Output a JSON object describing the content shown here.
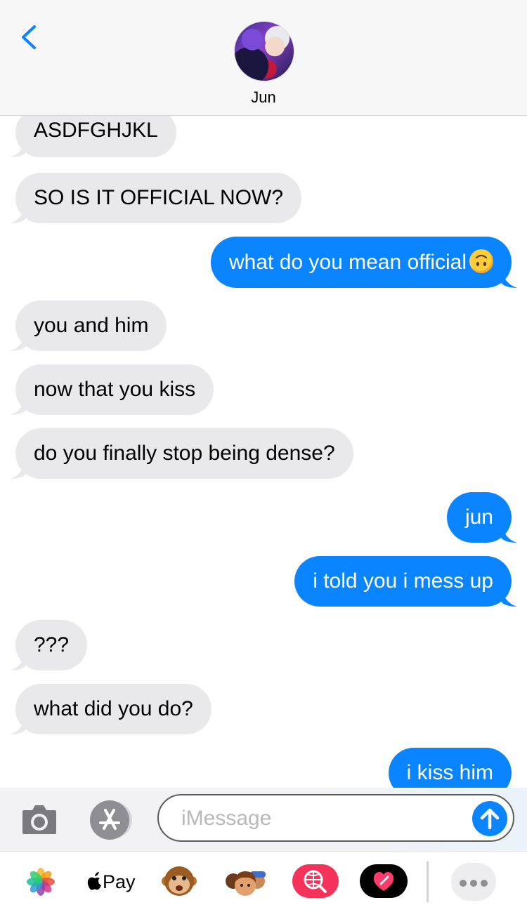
{
  "header": {
    "back_icon": "chevron-left-icon",
    "contact_name": "Jun",
    "accent_color": "#0b84ff"
  },
  "messages": [
    {
      "side": "received",
      "text": "ASDFGHJKL"
    },
    {
      "side": "received",
      "text": "SO IS IT OFFICIAL NOW?"
    },
    {
      "side": "sent",
      "text": "what do you mean official",
      "emoji": "upside-down-face"
    },
    {
      "side": "received",
      "text": "you and him"
    },
    {
      "side": "received",
      "text": "now that you kiss"
    },
    {
      "side": "received",
      "text": "do you finally stop being dense?"
    },
    {
      "side": "sent",
      "text": "jun"
    },
    {
      "side": "sent",
      "text": "i told you i mess up"
    },
    {
      "side": "received",
      "text": "???"
    },
    {
      "side": "received",
      "text": "what did you do?"
    },
    {
      "side": "sent",
      "text": "i kiss him"
    }
  ],
  "input_bar": {
    "placeholder": "iMessage",
    "value": "",
    "camera_icon": "camera-icon",
    "appstore_icon": "app-store-icon",
    "send_icon": "arrow-up-icon"
  },
  "app_drawer": {
    "apps": [
      {
        "name": "photos",
        "icon": "photos-icon"
      },
      {
        "name": "apple-pay",
        "icon": "apple-icon",
        "label": "Pay"
      },
      {
        "name": "animoji",
        "icon": "monkey-icon"
      },
      {
        "name": "memoji",
        "icon": "memoji-icon"
      },
      {
        "name": "web-images",
        "icon": "globe-search-icon"
      },
      {
        "name": "digital-touch",
        "icon": "heart-icon"
      }
    ],
    "more_icon": "more-icon"
  },
  "colors": {
    "sent_bubble": "#0b84ff",
    "received_bubble": "#e9e9eb"
  }
}
